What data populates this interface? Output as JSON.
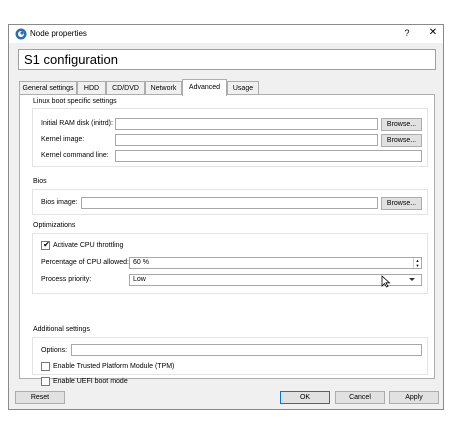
{
  "window": {
    "title": "Node properties",
    "help_label": "?",
    "close_label": "✕"
  },
  "header": {
    "title": "S1 configuration"
  },
  "tabs": [
    {
      "label": "General settings"
    },
    {
      "label": "HDD"
    },
    {
      "label": "CD/DVD"
    },
    {
      "label": "Network"
    },
    {
      "label": "Advanced"
    },
    {
      "label": "Usage"
    }
  ],
  "active_tab": "Advanced",
  "linux_boot": {
    "section_label": "Linux boot specific settings",
    "initrd_label": "Initial RAM disk (initrd):",
    "initrd_value": "",
    "kernel_image_label": "Kernel image:",
    "kernel_image_value": "",
    "kernel_cmdline_label": "Kernel command line:",
    "kernel_cmdline_value": "",
    "browse_label": "Browse..."
  },
  "bios": {
    "section_label": "Bios",
    "bios_image_label": "Bios image:",
    "bios_image_value": "",
    "browse_label": "Browse..."
  },
  "optimizations": {
    "section_label": "Optimizations",
    "cpu_throttling_label": "Activate CPU throttling",
    "cpu_throttling_checked": true,
    "cpu_percent_label": "Percentage of CPU allowed:",
    "cpu_percent_value": "60 %",
    "priority_label": "Process priority:",
    "priority_value": "Low"
  },
  "additional": {
    "section_label": "Additional settings",
    "options_label": "Options:",
    "options_value": "",
    "tpm_label": "Enable Trusted Platform Module (TPM)",
    "tpm_checked": false,
    "uefi_label": "Enable UEFI boot mode",
    "uefi_checked": false
  },
  "footer": {
    "reset_label": "Reset",
    "ok_label": "OK",
    "cancel_label": "Cancel",
    "apply_label": "Apply"
  },
  "colors": {
    "window_bg": "#f0f0f0",
    "panel_bg": "#ffffff",
    "default_button_border": "#0078d7"
  }
}
